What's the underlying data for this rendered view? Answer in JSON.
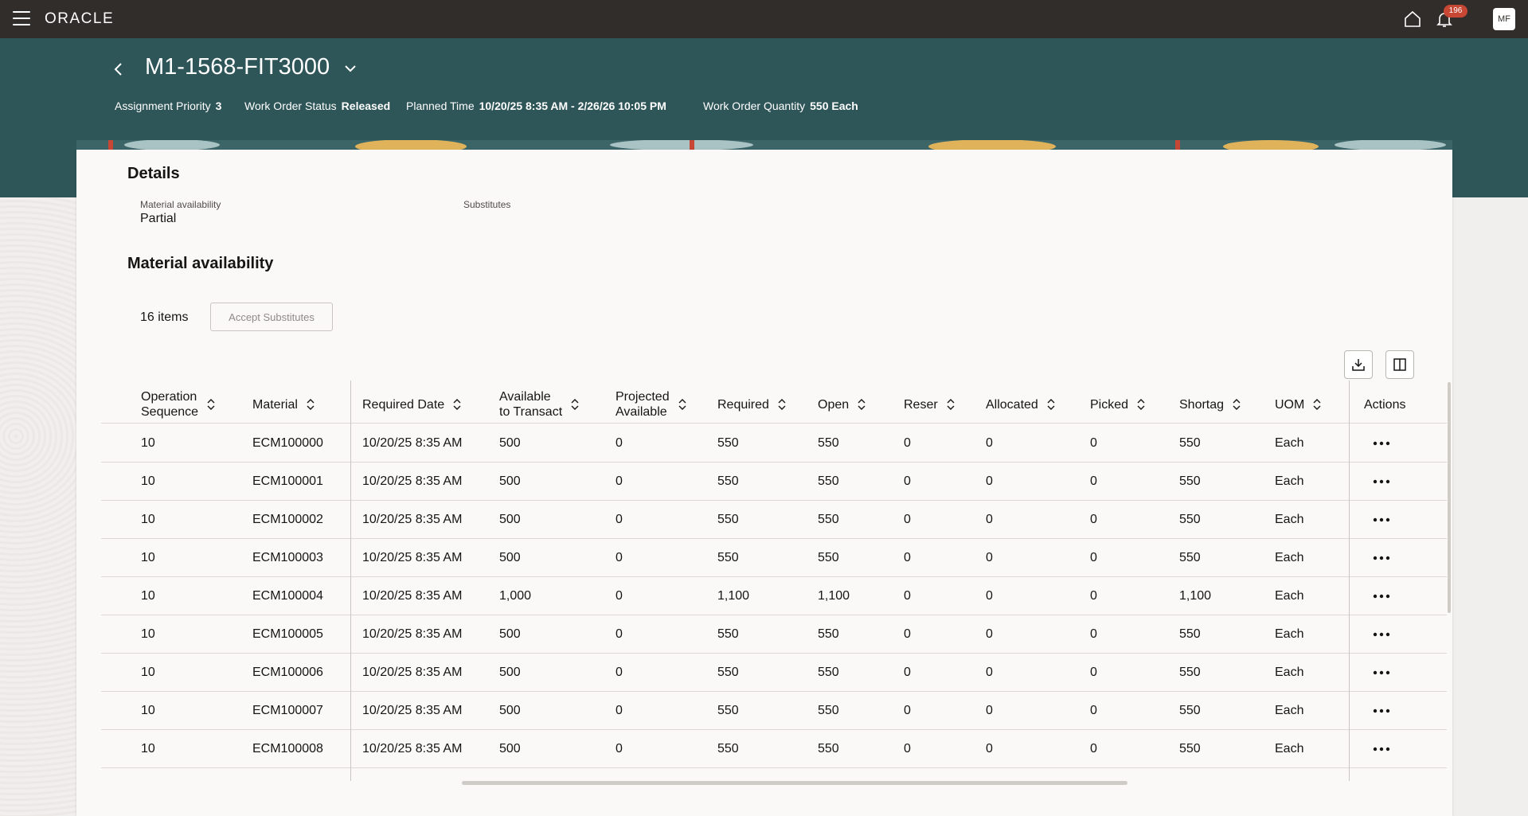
{
  "topbar": {
    "logo": "ORACLE",
    "notification_count": "196",
    "avatar_initials": "MF"
  },
  "header": {
    "title": "M1-1568-FIT3000",
    "meta": [
      {
        "label": "Assignment Priority",
        "value": "3"
      },
      {
        "label": "Work Order Status",
        "value": "Released"
      },
      {
        "label": "Planned Time",
        "value": "10/20/25 8:35 AM - 2/26/26 10:05 PM"
      },
      {
        "label": "Work Order Quantity",
        "value": "550 Each"
      }
    ]
  },
  "details": {
    "heading": "Details",
    "material_availability_label": "Material availability",
    "material_availability_value": "Partial",
    "substitutes_label": "Substitutes"
  },
  "material": {
    "heading": "Material availability",
    "items_count": "16 items",
    "accept_substitutes_label": "Accept Substitutes"
  },
  "table": {
    "columns": [
      {
        "line1": "Operation",
        "line2": "Sequence"
      },
      {
        "line1": "Material",
        "line2": ""
      },
      {
        "line1": "Required Date",
        "line2": ""
      },
      {
        "line1": "Available",
        "line2": "to Transact"
      },
      {
        "line1": "Projected",
        "line2": "Available"
      },
      {
        "line1": "Required",
        "line2": ""
      },
      {
        "line1": "Open",
        "line2": ""
      },
      {
        "line1": "Reser",
        "line2": ""
      },
      {
        "line1": "Allocated",
        "line2": ""
      },
      {
        "line1": "Picked",
        "line2": ""
      },
      {
        "line1": "Shortag",
        "line2": ""
      },
      {
        "line1": "UOM",
        "line2": ""
      },
      {
        "line1": "Actions",
        "line2": ""
      }
    ],
    "rows": [
      [
        "10",
        "ECM100000",
        "10/20/25 8:35 AM",
        "500",
        "0",
        "550",
        "550",
        "0",
        "0",
        "0",
        "550",
        "Each"
      ],
      [
        "10",
        "ECM100001",
        "10/20/25 8:35 AM",
        "500",
        "0",
        "550",
        "550",
        "0",
        "0",
        "0",
        "550",
        "Each"
      ],
      [
        "10",
        "ECM100002",
        "10/20/25 8:35 AM",
        "500",
        "0",
        "550",
        "550",
        "0",
        "0",
        "0",
        "550",
        "Each"
      ],
      [
        "10",
        "ECM100003",
        "10/20/25 8:35 AM",
        "500",
        "0",
        "550",
        "550",
        "0",
        "0",
        "0",
        "550",
        "Each"
      ],
      [
        "10",
        "ECM100004",
        "10/20/25 8:35 AM",
        "1,000",
        "0",
        "1,100",
        "1,100",
        "0",
        "0",
        "0",
        "1,100",
        "Each"
      ],
      [
        "10",
        "ECM100005",
        "10/20/25 8:35 AM",
        "500",
        "0",
        "550",
        "550",
        "0",
        "0",
        "0",
        "550",
        "Each"
      ],
      [
        "10",
        "ECM100006",
        "10/20/25 8:35 AM",
        "500",
        "0",
        "550",
        "550",
        "0",
        "0",
        "0",
        "550",
        "Each"
      ],
      [
        "10",
        "ECM100007",
        "10/20/25 8:35 AM",
        "500",
        "0",
        "550",
        "550",
        "0",
        "0",
        "0",
        "550",
        "Each"
      ],
      [
        "10",
        "ECM100008",
        "10/20/25 8:35 AM",
        "500",
        "0",
        "550",
        "550",
        "0",
        "0",
        "0",
        "550",
        "Each"
      ]
    ]
  }
}
